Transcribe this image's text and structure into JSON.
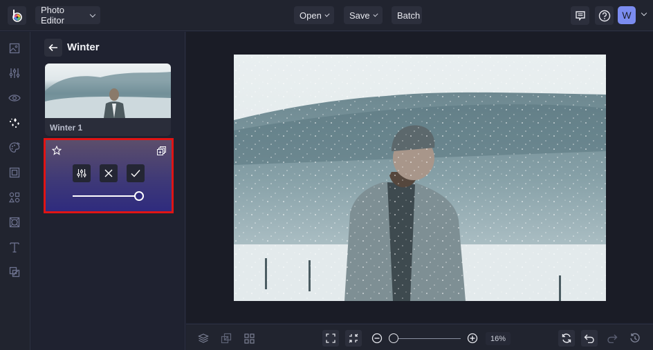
{
  "topbar": {
    "app_menu_label": "Photo Editor",
    "open_label": "Open",
    "save_label": "Save",
    "batch_label": "Batch",
    "avatar_initial": "W",
    "icons": [
      "logo-icon",
      "feedback-icon",
      "help-icon",
      "account-chevron-icon"
    ]
  },
  "left_rail": {
    "items": [
      {
        "name": "image-icon",
        "active": false
      },
      {
        "name": "adjust-icon",
        "active": false
      },
      {
        "name": "eye-icon",
        "active": false
      },
      {
        "name": "effects-icon",
        "active": true
      },
      {
        "name": "artsy-icon",
        "active": false
      },
      {
        "name": "frame-icon",
        "active": false
      },
      {
        "name": "graphics-icon",
        "active": false
      },
      {
        "name": "overlay-icon",
        "active": false
      },
      {
        "name": "text-icon",
        "active": false
      },
      {
        "name": "texture-icon",
        "active": false
      }
    ]
  },
  "panel": {
    "title": "Winter",
    "effect_thumb_label": "Winter 1",
    "effect_controls": {
      "intensity_percent": 100,
      "buttons": [
        "settings",
        "cancel",
        "apply"
      ]
    }
  },
  "bottombar": {
    "zoom_value": "16%",
    "zoom_slider_fraction": 0.0
  },
  "colors": {
    "accent": "#7b8cf0",
    "highlight_border": "#e01414",
    "bg": "#1e2130"
  }
}
